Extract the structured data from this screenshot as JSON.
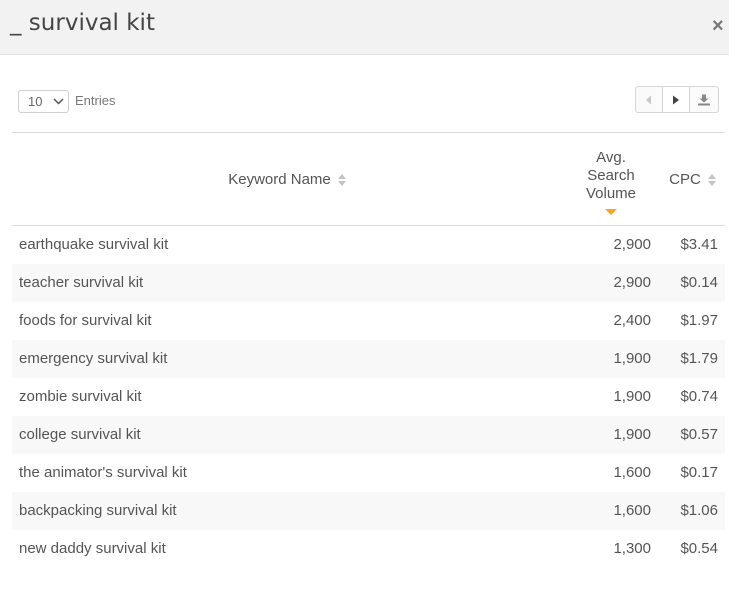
{
  "dialog": {
    "title": "_ survival kit",
    "close_label": "×"
  },
  "controls": {
    "page_size": "10",
    "entries_label": "Entries"
  },
  "table": {
    "columns": {
      "keyword": "Keyword Name",
      "volume_line1": "Avg.",
      "volume_line2": "Search",
      "volume_line3": "Volume",
      "cpc": "CPC"
    },
    "sort": {
      "column": "Avg. Search Volume",
      "direction": "descending"
    },
    "rows": [
      {
        "keyword": "earthquake survival kit",
        "volume": "2,900",
        "cpc": "$3.41"
      },
      {
        "keyword": "teacher survival kit",
        "volume": "2,900",
        "cpc": "$0.14"
      },
      {
        "keyword": "foods for survival kit",
        "volume": "2,400",
        "cpc": "$1.97"
      },
      {
        "keyword": "emergency survival kit",
        "volume": "1,900",
        "cpc": "$1.79"
      },
      {
        "keyword": "zombie survival kit",
        "volume": "1,900",
        "cpc": "$0.74"
      },
      {
        "keyword": "college survival kit",
        "volume": "1,900",
        "cpc": "$0.57"
      },
      {
        "keyword": "the animator's survival kit",
        "volume": "1,600",
        "cpc": "$0.17"
      },
      {
        "keyword": "backpacking survival kit",
        "volume": "1,600",
        "cpc": "$1.06"
      },
      {
        "keyword": "new daddy survival kit",
        "volume": "1,300",
        "cpc": "$0.54"
      }
    ]
  },
  "colors": {
    "sort_active": "#f5a623",
    "header_bg": "#f2f2f2",
    "row_alt": "#f8f8f8"
  }
}
